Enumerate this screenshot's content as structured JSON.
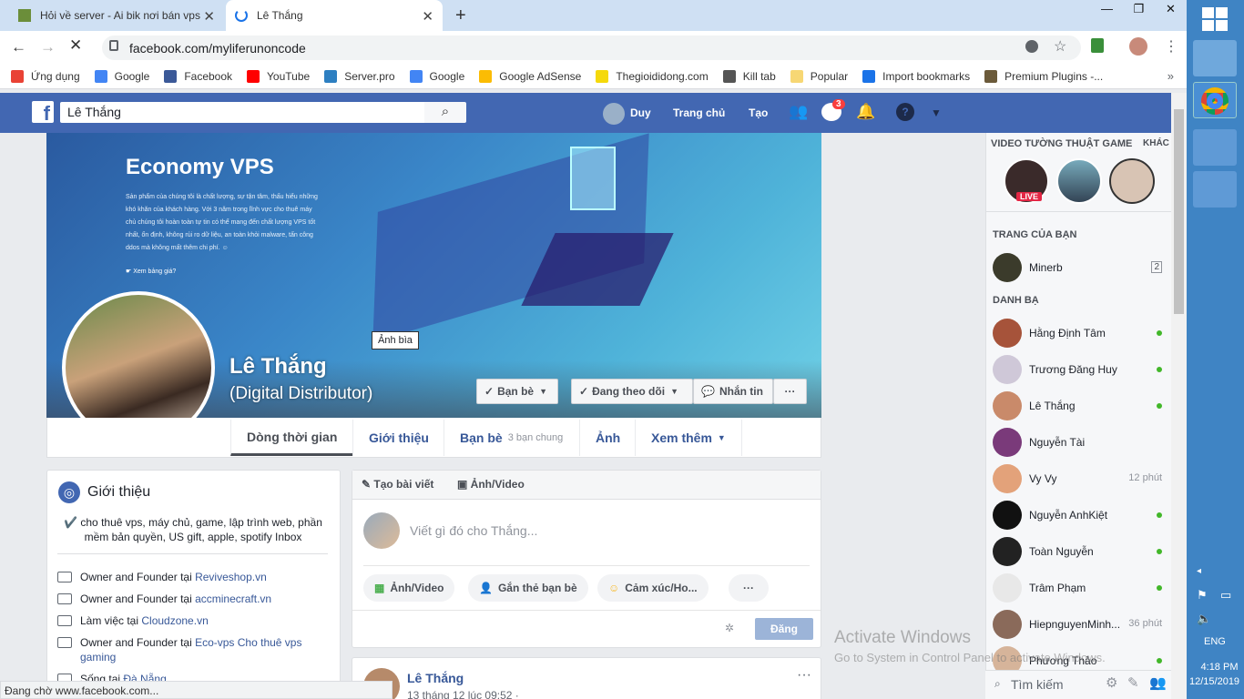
{
  "browser": {
    "tabs": [
      {
        "title": "Hỏi về server - Ai bik nơi bán vps"
      },
      {
        "title": "Lê Thắng"
      }
    ],
    "url": "facebook.com/myliferunoncode",
    "status": "Đang chờ www.facebook.com..."
  },
  "bookmarks": [
    {
      "label": "Ứng dụng",
      "color": "#e94235"
    },
    {
      "label": "Google",
      "color": "#4285f4"
    },
    {
      "label": "Facebook",
      "color": "#3b5998"
    },
    {
      "label": "YouTube",
      "color": "#ff0000"
    },
    {
      "label": "Server.pro",
      "color": "#2d7fc1"
    },
    {
      "label": "Google",
      "color": "#4285f4"
    },
    {
      "label": "Google AdSense",
      "color": "#fbbc04"
    },
    {
      "label": "Thegioididong.com",
      "color": "#f5d90b"
    },
    {
      "label": "Kill tab",
      "color": "#555555"
    },
    {
      "label": "Popular",
      "color": "#f7d774"
    },
    {
      "label": "Import bookmarks",
      "color": "#1a73e8"
    },
    {
      "label": "Premium Plugins -...",
      "color": "#6b5a3a"
    }
  ],
  "fb": {
    "search": "Lê Thắng",
    "user": "Duy",
    "home": "Trang chủ",
    "create": "Tạo",
    "messages_badge": "3"
  },
  "cover": {
    "headline": "Economy VPS",
    "body": "Sản phẩm của chúng tôi là chất lượng, sự tận tâm, thấu hiểu những khó khăn của khách hàng. Với 3 năm trong lĩnh vực cho thuê máy chủ chúng tôi hoàn toàn tự tin có thể mang đến chất lượng VPS tốt nhất, ổn định, không rủi ro dữ liệu, an toàn khỏi malware, tấn công ddos mà không mất thêm chi phí. ☺",
    "cta": "☛ Xem bảng giá?",
    "tooltip": "Ảnh bìa"
  },
  "profile": {
    "name": "Lê Thắng",
    "subtitle": "(Digital Distributor)",
    "btn_friends": "Bạn bè",
    "btn_following": "Đang theo dõi",
    "btn_message": "Nhắn tin",
    "btn_more": "···"
  },
  "nav": {
    "timeline": "Dòng thời gian",
    "about": "Giới thiệu",
    "friends": "Bạn bè",
    "mutual": "3 bạn chung",
    "photos": "Ảnh",
    "more": "Xem thêm"
  },
  "intro": {
    "title": "Giới thiệu",
    "bio": "✔️ cho thuê vps, máy chủ, game, lập trình web, phần mềm bản quyền, US gift, apple, spotify Inbox",
    "rows": [
      {
        "text": "Owner and Founder tại ",
        "link": "Reviveshop.vn"
      },
      {
        "text": "Owner and Founder tại ",
        "link": "accminecraft.vn"
      },
      {
        "text": "Làm việc tại ",
        "link": "Cloudzone.vn"
      },
      {
        "text": "Owner and Founder tại ",
        "link": "Eco-vps Cho thuê vps gaming"
      },
      {
        "text": "Sống tại ",
        "link": "Đà Nẵng"
      }
    ]
  },
  "composer": {
    "tab_post": "Tạo bài viết",
    "tab_photo": "Ảnh/Video",
    "placeholder": "Viết gì đó cho Thắng...",
    "photo": "Ảnh/Video",
    "tag": "Gắn thẻ bạn bè",
    "feeling": "Cảm xúc/Ho...",
    "post": "Đăng"
  },
  "post": {
    "author": "Lê Thắng",
    "time": "13 tháng 12 lúc 09:52 ·"
  },
  "sidebar": {
    "videos_title": "VIDEO TƯỜNG THUẬT GAME",
    "more": "KHÁC",
    "live": "LIVE",
    "pages_title": "TRANG CỦA BẠN",
    "page": "Minerb",
    "page_count": "2",
    "contacts_title": "DANH BẠ",
    "contacts": [
      {
        "name": "Hằng Định Tâm",
        "online": true,
        "color": "#a6533a"
      },
      {
        "name": "Trương Đăng Huy",
        "online": true,
        "color": "#cfc8d8"
      },
      {
        "name": "Lê Thắng",
        "online": true,
        "color": "#c98a6a"
      },
      {
        "name": "Nguyễn Tài",
        "online": false,
        "time": "",
        "color": "#7a3a7a"
      },
      {
        "name": "Vy Vy",
        "online": false,
        "time": "12 phút",
        "color": "#e3a27a"
      },
      {
        "name": "Nguyễn AnhKiệt",
        "online": true,
        "color": "#111111"
      },
      {
        "name": "Toàn Nguyễn",
        "online": true,
        "color": "#222222"
      },
      {
        "name": "Trâm Phạm",
        "online": true,
        "color": "#e8e8e8"
      },
      {
        "name": "HiepnguyenMinh...",
        "online": false,
        "time": "36 phút",
        "color": "#8a6a5a"
      },
      {
        "name": "Phương Thảo",
        "online": true,
        "color": "#d6b49a"
      }
    ],
    "search": "Tìm kiếm"
  },
  "watermark": {
    "line1": "Activate Windows",
    "line2": "Go to System in Control Panel to activate Windows."
  },
  "taskbar": {
    "lang": "ENG",
    "time": "4:18 PM",
    "date": "12/15/2019"
  }
}
